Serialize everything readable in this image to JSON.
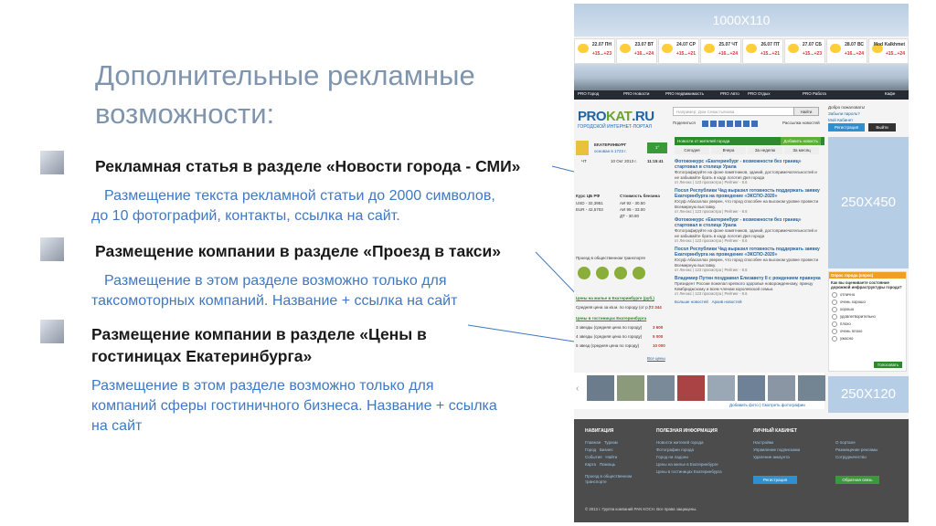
{
  "slide": {
    "title": "Дополнительные рекламные возможности:",
    "items": [
      {
        "heading": "Рекламная статья в разделе «Новости города - СМИ»",
        "desc": "Размещение текста рекламной статьи до 2000 символов, до 10 фотографий, контакты, ссылка на сайт."
      },
      {
        "heading": "Размещение компании в разделе «Проезд в такси»",
        "desc": "Размещение в этом разделе возможно только для таксомоторных компаний. Название + ссылка на сайт"
      },
      {
        "heading": "Размещение компании в разделе «Цены в гостиницах Екатеринбурга»",
        "desc": "Размещение в этом разделе возможно только для компаний сферы гостиничного бизнеса. Название + ссылка на сайт"
      }
    ]
  },
  "site": {
    "top_banner": "1000Х110",
    "weather": [
      {
        "day": "22.07 ПН",
        "temp": "+15...+23"
      },
      {
        "day": "23.07 ВТ",
        "temp": "+16...+24"
      },
      {
        "day": "24.07 СР",
        "temp": "+15...+21"
      },
      {
        "day": "25.07 ЧТ",
        "temp": "+16...+24"
      },
      {
        "day": "26.07 ПТ",
        "temp": "+15...+21"
      },
      {
        "day": "27.07 СБ",
        "temp": "+15...+23"
      },
      {
        "day": "28.07 ВС",
        "temp": "+16...+24"
      },
      {
        "day": "Mod Kalkhmet",
        "temp": "+15...+24"
      }
    ],
    "nav": [
      "PRO Город",
      "PRO Новости",
      "PRO Недвижимость",
      "PRO Авто",
      "PRO Отдых",
      "PRO Работа",
      "Кафе"
    ],
    "logo_main": "PRO",
    "logo_accent": "KAT",
    "logo_tld": ".RU",
    "logo_sub": "ГОРОДСКОЙ ИНТЕРНЕТ-ПОРТАЛ",
    "search_placeholder": "Например: Дом Севастьянова",
    "search_button": "Найти",
    "login_text": "Добро пожаловать!",
    "login_links": [
      "Забыли пароль?",
      "Мой Кабинет"
    ],
    "register_button": "Регистрация",
    "logout_button": "Выйти",
    "share_label": "Поделиться",
    "rss_label": "Рассылка новостей",
    "city": "ЕКАТЕРИНБУРГ",
    "founded": "основан в 1723 г.",
    "date_row": [
      "ЧТ",
      "10 Окт 2013 г.",
      "11:15:41"
    ],
    "rates_header": [
      "Курс ЦБ РФ",
      "Стоимость бензина"
    ],
    "rates": [
      "USD - 32,3951",
      "EUR - 42,5703",
      "АИ 92 - 30.50",
      "АИ 95 - 33.00",
      "ДТ - 30.80"
    ],
    "transport_title": "Проезд в общественном транспорте",
    "transport_icons": [
      "Метро",
      "Трамвай",
      "Троллейбус",
      "Автобус"
    ],
    "hotel_title": "Цены на жилье в Екатеринбурге (руб.)",
    "hotel_avg": "Средняя цена за кв.м. по городу (от р.)",
    "hotel_avg_val": "72 344",
    "hotel_sub": "Цены в гостиницах Екатеринбурга",
    "hotel_rows": [
      {
        "label": "3 звезды (средняя цена по городу)",
        "value": "3 600"
      },
      {
        "label": "4 звезды (средняя цена по городу)",
        "value": "5 000"
      },
      {
        "label": "5 звезд (средняя цена по городу)",
        "value": "10 000"
      }
    ],
    "all_prices": "Все цены",
    "news_header": "Новости от жителей города",
    "news_add": "Добавить новость",
    "tabs": [
      "Сегодня",
      "Вчера",
      "За неделю",
      "За месяц"
    ],
    "news": [
      {
        "title": "Фотоконкурс «Екатеринбург - возможности без границ» стартовал в столице Урала",
        "text": "Фотографируйте на фоне памятников, зданий, достопримечательностей и не забывайте брать в кадр логотип Дня города",
        "meta": "от Ленэкс | 123 просмотра | Рейтинг - 8.6"
      },
      {
        "title": "Посол Республики Чад выразил готовность поддержать заявку Екатеринбурга на проведение «ЭКСПО-2020»",
        "text": "Юсуф Абасаллах уверен, что город способен на высоком уровне провести Всемирную выставку.",
        "meta": "от Ленэкс | 123 просмотра | Рейтинг - 8.6"
      },
      {
        "title": "Фотоконкурс «Екатеринбург - возможности без границ» стартовал в столице Урала",
        "text": "Фотографируйте на фоне памятников, зданий, достопримечательностей и не забывайте брать в кадр логотип Дня города",
        "meta": "от Ленэкс | 123 просмотра | Рейтинг - 8.6"
      },
      {
        "title": "Посол Республики Чад выразил готовность поддержать заявку Екатеринбурга на проведение «ЭКСПО-2020»",
        "text": "Юсуф Абасаллах уверен, что город способен на высоком уровне провести Всемирную выставку.",
        "meta": "от Ленэкс | 123 просмотра | Рейтинг - 8.6"
      },
      {
        "title": "Владимир Путин поздравил Елизавету II с рождением правнука",
        "text": "Президент России пожелал крепкого здоровья новорожденному, принцу Кембриджскому и всем членам королевской семьи.",
        "meta": "от Ленэкс | 123 просмотра | Рейтинг - 8.6"
      }
    ],
    "news_more": [
      "Больше новостей",
      "Архив новостей"
    ],
    "ad_right_1": "250Х450",
    "ad_right_2": "250Х120",
    "poll_header": "Опрос города (опрос)",
    "poll_question": "Как вы оцениваете состояние дорожной инфраструктуры города?",
    "poll_options": [
      "отлично",
      "очень хорошо",
      "хорошо",
      "удовлетворительно",
      "плохо",
      "очень плохо",
      "ужасно"
    ],
    "poll_button": "Голосовать",
    "photo_links": [
      "Добавить фото",
      "Смотреть фотографии"
    ],
    "footer": {
      "nav_title": "НАВИГАЦИЯ",
      "nav_links": [
        "Главная",
        "Туризм",
        "Город",
        "Бизнес",
        "События",
        "Найти",
        "Карта",
        "Помощь",
        "Проезд в общественном транспорте"
      ],
      "info_title": "ПОЛЕЗНАЯ ИНФОРМАЦИЯ",
      "info_links": [
        "Новости жителей города",
        "Фотографии города",
        "Город на ладони",
        "Цены на жилье в Екатеринбурге",
        "Цены в гостиницах Екатеринбурга"
      ],
      "cab_title": "ЛИЧНЫЙ КАБИНЕТ",
      "cab_links": [
        "Настройки",
        "Управление подписками",
        "Удаление аккаунта"
      ],
      "right_links": [
        "О портале",
        "Размещение рекламы",
        "Сотрудничество"
      ],
      "register": "Регистрация",
      "feedback": "Обратная связь",
      "copyright": "© 2013 г. Группа компаний PAN KOCH. Все права защищены."
    }
  }
}
